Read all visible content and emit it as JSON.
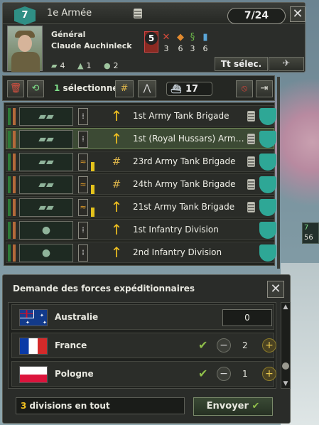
{
  "army": {
    "division_count_badge": "7",
    "name": "1e Armée",
    "divisions_ratio": "7/24",
    "general_title": "Général",
    "general_name": "Claude Auchinleck",
    "skill": "5",
    "stats": {
      "attack": "3",
      "defense": "6",
      "planning": "3",
      "logistics": "6"
    },
    "unit_counts": {
      "tanks": "4",
      "mountain": "1",
      "infantry": "2"
    },
    "select_all_label": "Tt sélec."
  },
  "toolbar": {
    "selected_count": "1",
    "selected_label": "sélectionné",
    "naval_count": "17"
  },
  "divisions": [
    {
      "name": "1st Army Tank Brigade",
      "selected": false,
      "unit": "tank",
      "rank": "1",
      "action": "arrow"
    },
    {
      "name": "1st (Royal Hussars) Arm…",
      "selected": true,
      "unit": "tank",
      "rank": "1",
      "action": "arrow"
    },
    {
      "name": "23rd Army Tank Brigade",
      "selected": false,
      "unit": "tank",
      "rank": "chevron",
      "action": "rail"
    },
    {
      "name": "24th Army Tank Brigade",
      "selected": false,
      "unit": "tank",
      "rank": "chevron",
      "action": "rail"
    },
    {
      "name": "21st Army Tank Brigade",
      "selected": false,
      "unit": "tank",
      "rank": "chevron",
      "action": "arrow"
    },
    {
      "name": "1st Infantry Division",
      "selected": false,
      "unit": "infantry",
      "rank": "1",
      "action": "arrow"
    },
    {
      "name": "2nd Infantry Division",
      "selected": false,
      "unit": "infantry",
      "rank": "1",
      "action": "arrow"
    }
  ],
  "expedition": {
    "title": "Demande des forces expéditionnaires",
    "countries": [
      {
        "name": "Australie",
        "value": "0"
      },
      {
        "name": "France",
        "value": "2"
      },
      {
        "name": "Pologne",
        "value": "1"
      }
    ],
    "total_number": "3",
    "total_label": "divisions en tout",
    "send_label": "Envoyer"
  },
  "map_labels": {
    "top": "7",
    "bottom": "56"
  },
  "colors": {
    "teal_badge": "#2f8f85",
    "accent_yellow": "#f0c020",
    "green": "#7fe08a"
  }
}
